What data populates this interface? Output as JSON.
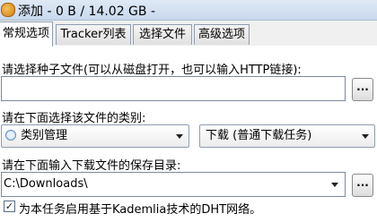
{
  "window": {
    "title": "添加 - 0 B / 14.02 GB -"
  },
  "tabs": [
    {
      "label": "常规选项",
      "active": true
    },
    {
      "label": "Tracker列表",
      "active": false
    },
    {
      "label": "选择文件",
      "active": false
    },
    {
      "label": "高级选项",
      "active": false
    }
  ],
  "torrent": {
    "label": "请选择种子文件(可以从磁盘打开，也可以输入HTTP链接):",
    "value": "",
    "browse_label": "..."
  },
  "category": {
    "label": "请在下面选择该文件的类别:",
    "selected": "类别管理",
    "download_type": "下载 (普通下载任务)"
  },
  "save_dir": {
    "label": "请在下面输入下载文件的保存目录:",
    "value": "C:\\Downloads\\",
    "browse_label": "..."
  },
  "dht": {
    "checked": true,
    "check_mark": "✓",
    "label": "为本任务启用基于Kademlia技术的DHT网络。"
  }
}
